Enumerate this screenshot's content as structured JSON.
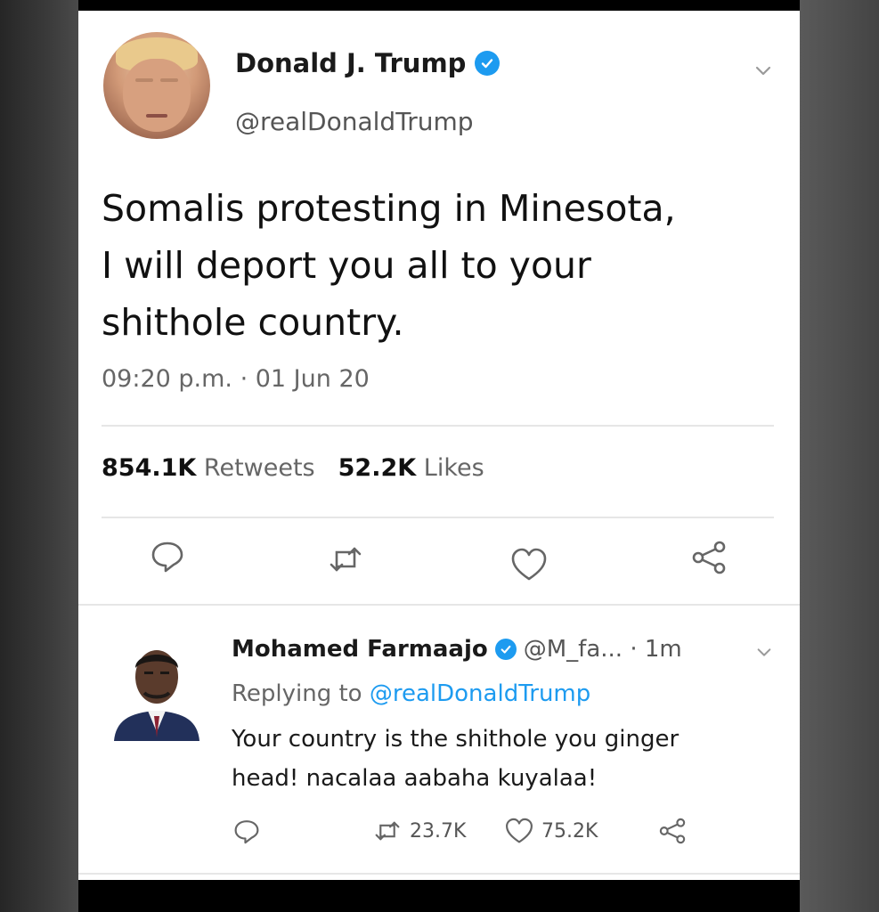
{
  "tweet": {
    "author_name": "Donald J. Trump",
    "handle": "@realDonaldTrump",
    "text": "Somalis protesting in Minesota,\nI will deport you all to your\nshithole country.",
    "timestamp": "09:20 p.m. · 01 Jun 20",
    "retweets_count": "854.1K",
    "retweets_label": "Retweets",
    "likes_count": "52.2K",
    "likes_label": "Likes"
  },
  "reply": {
    "author_name": "Mohamed Farmaajo",
    "meta": "@M_fa... · 1m",
    "replying_prefix": "Replying to",
    "replying_to": "@realDonaldTrump",
    "text": "Your country is the shithole you ginger\nhead! nacalaa aabaha kuyalaa!",
    "retweets": "23.7K",
    "likes": "75.2K"
  },
  "colors": {
    "verified": "#1d9bf0",
    "mention": "#1d9bf0",
    "muted_text": "#666666"
  },
  "icons": [
    "chevron-down-icon",
    "verified-badge-icon",
    "reply-icon",
    "retweet-icon",
    "like-icon",
    "share-icon"
  ]
}
